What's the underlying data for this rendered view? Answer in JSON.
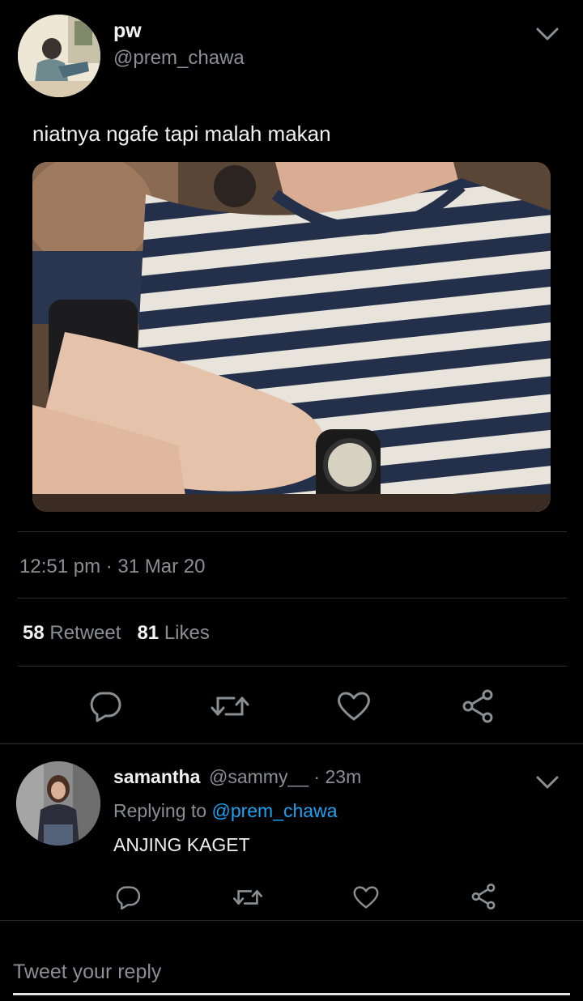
{
  "tweet": {
    "display_name": "pw",
    "handle": "@prem_chawa",
    "text": "niatnya ngafe tapi malah makan",
    "timestamp": "12:51 pm · 31 Mar 20",
    "retweet_count": "58",
    "retweet_label": "Retweet",
    "likes_count": "81",
    "likes_label": "Likes"
  },
  "reply": {
    "display_name": "samantha",
    "handle": "@sammy__",
    "separator": " · ",
    "time": "23m",
    "replying_prefix": "Replying to ",
    "replying_mention": "@prem_chawa",
    "text": "ANJING KAGET"
  },
  "composer": {
    "placeholder": "Tweet your reply"
  },
  "icons": {
    "chevron": "chevron-down-icon",
    "reply": "reply-icon",
    "retweet": "retweet-icon",
    "like": "heart-icon",
    "share": "share-icon"
  },
  "colors": {
    "background": "#000000",
    "secondary_text": "#8a8f94",
    "link": "#1da1f2",
    "divider": "#2a2d30"
  }
}
